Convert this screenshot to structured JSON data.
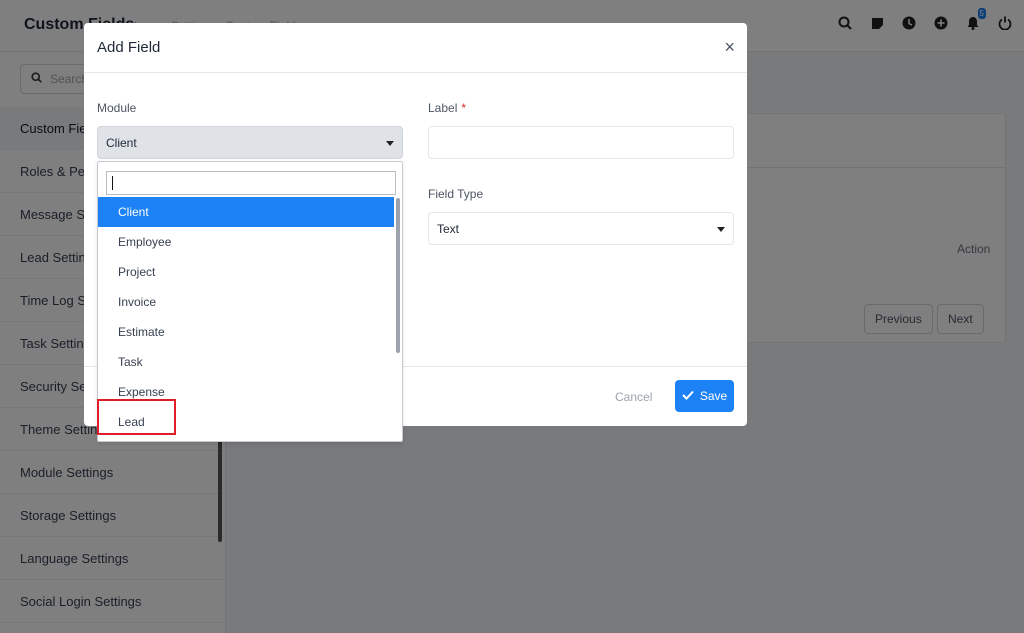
{
  "header": {
    "title": "Custom Fields",
    "breadcrumb": "Home • Settings • Custom Fields",
    "notification_count": "5"
  },
  "sidebar": {
    "search_placeholder": "Search",
    "items": [
      {
        "label": "Custom Fields"
      },
      {
        "label": "Roles & Permissions"
      },
      {
        "label": "Message Settings"
      },
      {
        "label": "Lead Settings"
      },
      {
        "label": "Time Log Settings"
      },
      {
        "label": "Task Settings"
      },
      {
        "label": "Security Settings"
      },
      {
        "label": "Theme Settings"
      },
      {
        "label": "Module Settings"
      },
      {
        "label": "Storage Settings"
      },
      {
        "label": "Language Settings"
      },
      {
        "label": "Social Login Settings"
      }
    ]
  },
  "table": {
    "action_header": "Action",
    "previous_label": "Previous",
    "next_label": "Next"
  },
  "modal": {
    "title": "Add Field",
    "close_symbol": "×",
    "module_label": "Module",
    "module_value": "Client",
    "label_label": "Label",
    "required_mark": "*",
    "label_value": "",
    "field_type_label": "Field Type",
    "field_type_value": "Text",
    "cancel_label": "Cancel",
    "save_label": "Save"
  },
  "dropdown": {
    "search_value": "",
    "options": [
      {
        "label": "Client"
      },
      {
        "label": "Employee"
      },
      {
        "label": "Project"
      },
      {
        "label": "Invoice"
      },
      {
        "label": "Estimate"
      },
      {
        "label": "Task"
      },
      {
        "label": "Expense"
      },
      {
        "label": "Lead"
      }
    ],
    "selected": "Client",
    "highlighted": "Lead"
  },
  "colors": {
    "accent": "#1d82f5",
    "highlight_border": "#e11d2a",
    "overlay": "rgba(0,0,0,0.5)"
  }
}
